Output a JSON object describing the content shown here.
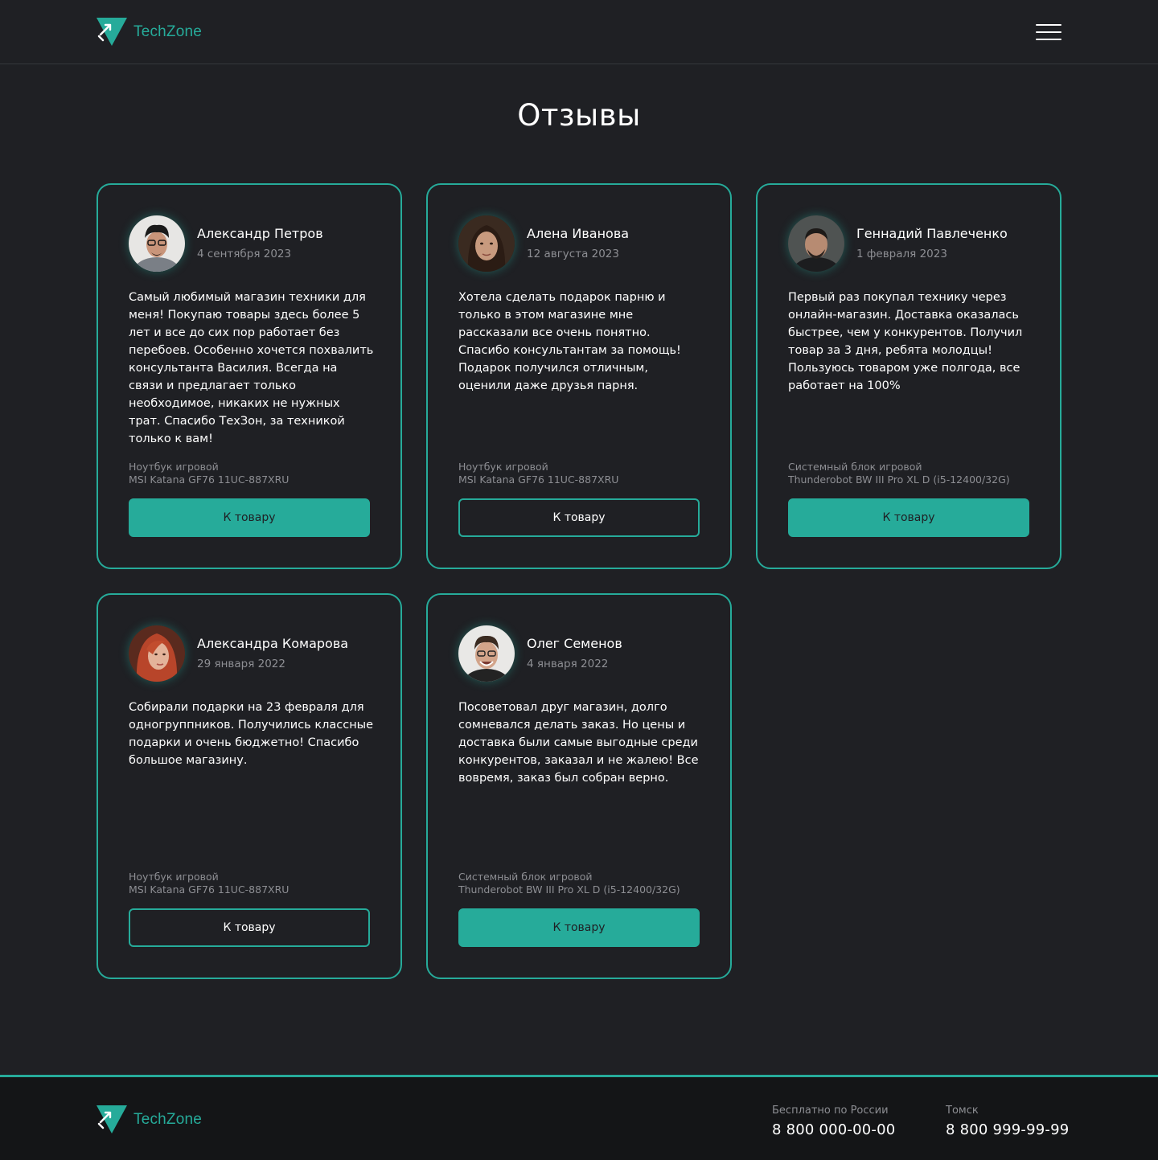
{
  "brand": {
    "name": "TechZone",
    "accent_color": "#26ab9a",
    "background_color": "#1f2024"
  },
  "header": {
    "menu_icon": "hamburger-menu-icon"
  },
  "page": {
    "title": "Отзывы"
  },
  "reviews": [
    {
      "name": "Александр Петров",
      "date": "4 сентября 2023",
      "text": "Самый любимый магазин техники для меня! Покупаю товары здесь более 5 лет и все до сих пор работает без перебоев. Особенно хочется похвалить консультанта Василия. Всегда на связи и предлагает только необходимое, никаких не нужных трат. Спасибо ТехЗон, за техникой только к вам!",
      "product_category": "Ноутбук игровой",
      "product_model": "MSI Katana GF76 11UC-887XRU",
      "button_label": "К товару",
      "button_style": "filled"
    },
    {
      "name": "Алена Иванова",
      "date": "12 августа 2023",
      "text": "Хотела сделать подарок парню и только в этом магазине мне рассказали все очень понятно. Спасибо консультантам за помощь! Подарок получился отличным, оценили даже друзья парня.",
      "product_category": "Ноутбук игровой",
      "product_model": "MSI Katana GF76 11UC-887XRU",
      "button_label": "К товару",
      "button_style": "outline"
    },
    {
      "name": "Геннадий Павлеченко",
      "date": "1 февраля 2023",
      "text": "Первый раз покупал технику через онлайн-магазин. Доставка оказалась быстрее, чем у конкурентов. Получил товар за 3 дня, ребята молодцы! Пользуюсь товаром уже полгода, все работает на 100%",
      "product_category": "Системный блок игровой",
      "product_model": "Thunderobot BW III Pro XL D (i5-12400/32G)",
      "button_label": "К товару",
      "button_style": "filled"
    },
    {
      "name": "Александра Комарова",
      "date": "29 января 2022",
      "text": "Собирали подарки на 23 февраля для одногруппников. Получились классные подарки и очень бюджетно! Спасибо большое магазину.",
      "product_category": "Ноутбук игровой",
      "product_model": "MSI Katana GF76 11UC-887XRU",
      "button_label": "К товару",
      "button_style": "outline"
    },
    {
      "name": "Олег Семенов",
      "date": "4 января 2022",
      "text": "Посоветовал друг магазин, долго сомневался делать заказ. Но цены и доставка были самые выгодные среди конкурентов, заказал и не жалею! Все вовремя, заказ был собран верно.",
      "product_category": "Системный блок игровой",
      "product_model": "Thunderobot BW III Pro XL D (i5-12400/32G)",
      "button_label": "К товару",
      "button_style": "filled"
    }
  ],
  "footer": {
    "contacts": [
      {
        "label": "Бесплатно по России",
        "phone": "8 800 000-00-00"
      },
      {
        "label": "Томск",
        "phone": "8 800 999-99-99"
      }
    ]
  }
}
